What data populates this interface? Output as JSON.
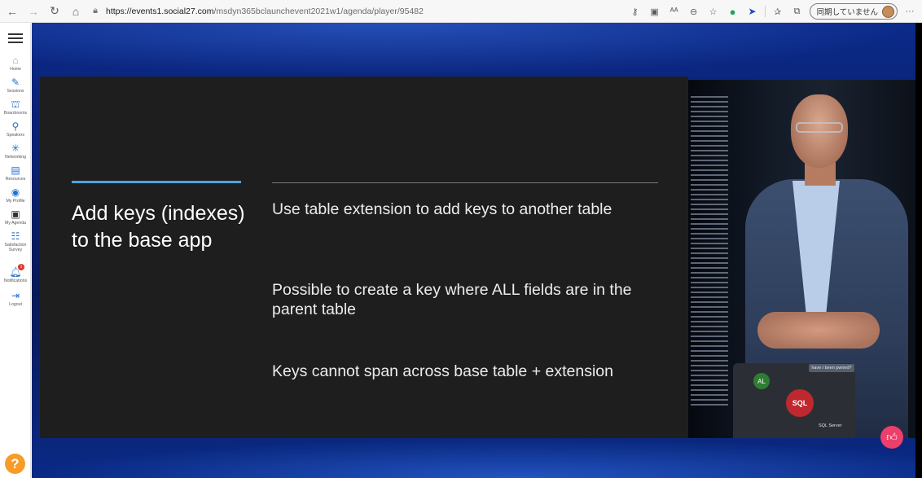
{
  "browser": {
    "url_host": "https://events1.social27.com",
    "url_path": "/msdyn365bclaunchevent2021w1/agenda/player/95482",
    "sync_label": "同期していません",
    "more_label": "···"
  },
  "sidebar": {
    "items": [
      {
        "label": "Home",
        "icon": "home-icon"
      },
      {
        "label": "Sessions",
        "icon": "pencil-icon"
      },
      {
        "label": "Boardrooms",
        "icon": "boardroom-icon"
      },
      {
        "label": "Speakers",
        "icon": "speaker-icon"
      },
      {
        "label": "Networking",
        "icon": "network-icon"
      },
      {
        "label": "Resources",
        "icon": "resources-icon"
      },
      {
        "label": "My Profile",
        "icon": "profile-icon"
      },
      {
        "label": "My Agenda",
        "icon": "agenda-icon"
      },
      {
        "label": "Satisfaction Survey",
        "icon": "survey-icon"
      },
      {
        "label": "Notifications",
        "icon": "bell-icon"
      },
      {
        "label": "Logout",
        "icon": "logout-icon"
      }
    ],
    "notification_count": "1",
    "help_label": "?"
  },
  "slide": {
    "title": "Add keys (indexes) to the base app",
    "bullets": [
      "Use table extension to add keys to another table",
      "Possible to create a key where ALL fields are in the parent table",
      "Keys cannot span across base table + extension"
    ]
  },
  "video": {
    "laptop_caption": "have i been pwned?",
    "sticker_sql": "SQL",
    "sticker_al": "AL",
    "laptop_logo": "SQL Server"
  },
  "colors": {
    "accent_blue": "#4aa3df",
    "like_pink": "#ec3f6c",
    "help_orange": "#f79c28",
    "slide_bg": "#1e1e1e"
  }
}
